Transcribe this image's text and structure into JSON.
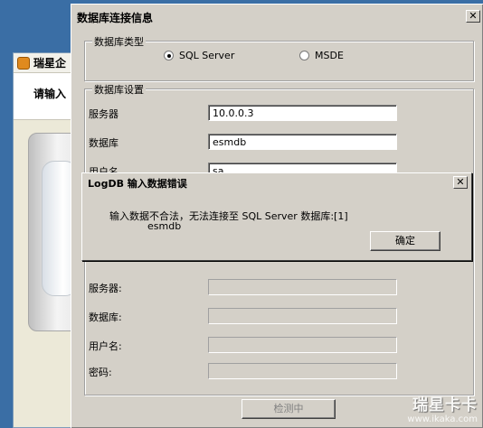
{
  "background_window": {
    "title": "瑞星企",
    "banner_text": "请输入"
  },
  "db_dialog": {
    "title": "数据库连接信息",
    "close": "✕",
    "db_type_group": {
      "label": "数据库类型",
      "options": [
        {
          "label": "SQL Server",
          "selected": true
        },
        {
          "label": "MSDE",
          "selected": false
        }
      ]
    },
    "settings_group": {
      "label": "数据库设置",
      "fields": [
        {
          "label": "服务器",
          "value": "10.0.0.3"
        },
        {
          "label": "数据库",
          "value": "esmdb"
        },
        {
          "label": "用户名",
          "value": "sa"
        }
      ]
    },
    "second_group": {
      "fields": [
        {
          "label": "服务器:",
          "value": ""
        },
        {
          "label": "数据库:",
          "value": ""
        },
        {
          "label": "用户名:",
          "value": ""
        },
        {
          "label": "密码:",
          "value": ""
        }
      ]
    },
    "detect_button": "检测中"
  },
  "error_dialog": {
    "title": "LogDB  输入数据错误",
    "close": "✕",
    "message_line1": "输入数据不合法，无法连接至 SQL Server 数据库:[1]",
    "message_line2": "esmdb",
    "ok_button": "确定"
  },
  "watermark": {
    "brand": "瑞星卡卡",
    "url": "www.ikaka.com"
  }
}
